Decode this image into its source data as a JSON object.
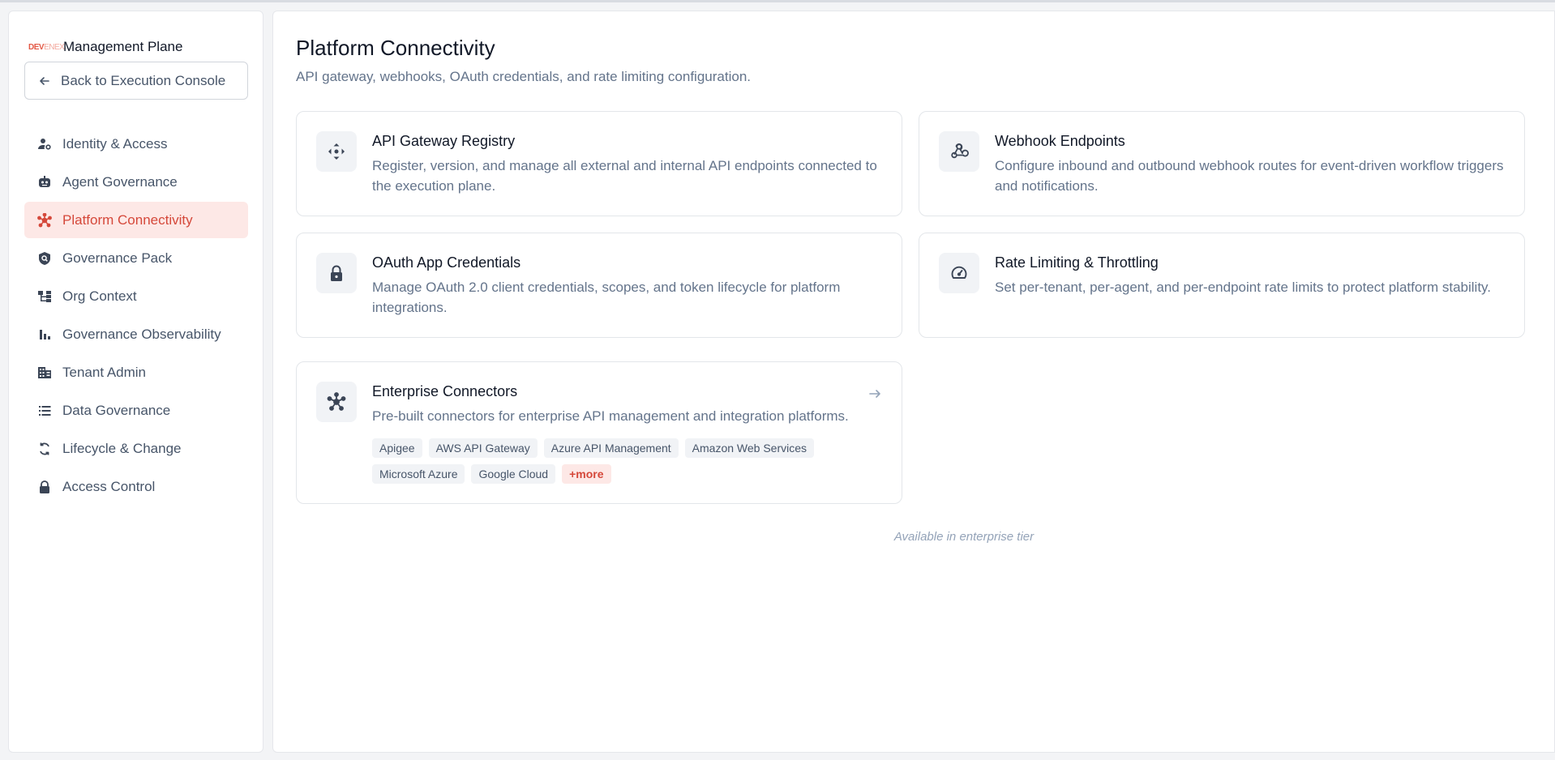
{
  "sidebar": {
    "brand": {
      "logo_a": "DEV",
      "logo_b": "ENEX",
      "title": "Management Plane"
    },
    "back_label": "Back to Execution Console",
    "items": [
      {
        "label": "Identity & Access",
        "icon": "user-gear-icon"
      },
      {
        "label": "Agent Governance",
        "icon": "robot-icon"
      },
      {
        "label": "Platform Connectivity",
        "icon": "hub-icon",
        "active": true
      },
      {
        "label": "Governance Pack",
        "icon": "shield-search-icon"
      },
      {
        "label": "Org Context",
        "icon": "org-tree-icon"
      },
      {
        "label": "Governance Observability",
        "icon": "bar-chart-icon"
      },
      {
        "label": "Tenant Admin",
        "icon": "building-icon"
      },
      {
        "label": "Data Governance",
        "icon": "list-icon"
      },
      {
        "label": "Lifecycle & Change",
        "icon": "cycle-icon"
      },
      {
        "label": "Access Control",
        "icon": "lock-icon"
      }
    ]
  },
  "main": {
    "title": "Platform Connectivity",
    "subtitle": "API gateway, webhooks, OAuth credentials, and rate limiting configuration.",
    "cards": [
      {
        "title": "API Gateway Registry",
        "description": "Register, version, and manage all external and internal API endpoints connected to the execution plane.",
        "icon": "move-arrows-icon"
      },
      {
        "title": "Webhook Endpoints",
        "description": "Configure inbound and outbound webhook routes for event-driven workflow triggers and notifications.",
        "icon": "webhook-icon"
      },
      {
        "title": "OAuth App Credentials",
        "description": "Manage OAuth 2.0 client credentials, scopes, and token lifecycle for platform integrations.",
        "icon": "lock-icon"
      },
      {
        "title": "Rate Limiting & Throttling",
        "description": "Set per-tenant, per-agent, and per-endpoint rate limits to protect platform stability.",
        "icon": "speedometer-icon"
      }
    ],
    "enterprise": {
      "title": "Enterprise Connectors",
      "description": "Pre-built connectors for enterprise API management and integration platforms.",
      "icon": "hub-icon",
      "tags": [
        "Apigee",
        "AWS API Gateway",
        "Azure API Management",
        "Amazon Web Services",
        "Microsoft Azure",
        "Google Cloud"
      ],
      "more_label": "+more"
    },
    "tier_note": "Available in enterprise tier"
  },
  "colors": {
    "accent": "#d5483a",
    "accent_bg": "#fde8e6",
    "icon": "#3b4556"
  }
}
